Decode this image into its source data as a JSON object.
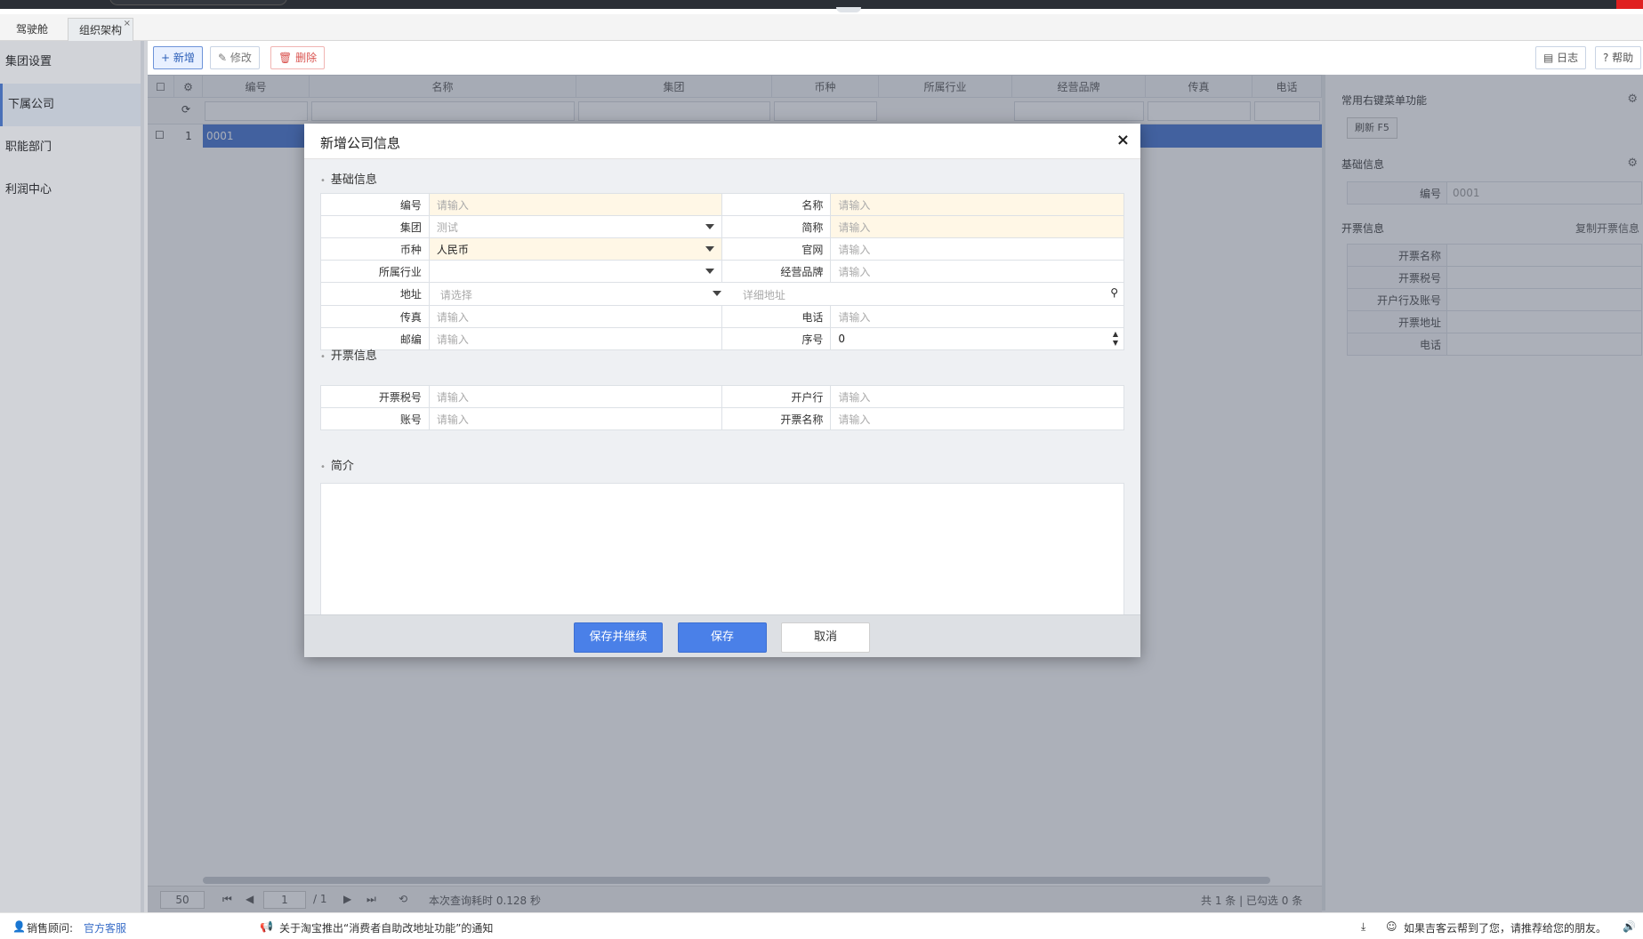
{
  "tabs": [
    {
      "label": "驾驶舱"
    },
    {
      "label": "组织架构",
      "close": "×"
    }
  ],
  "left_nav": [
    "集团设置",
    "下属公司",
    "职能部门",
    "利润中心"
  ],
  "toolbar": {
    "add_label": "+ 新增",
    "edit_label": "修改",
    "delete_label": "删除",
    "log_label": "日志",
    "help_label": "? 帮助"
  },
  "grid": {
    "columns": [
      "编号",
      "名称",
      "集团",
      "币种",
      "所属行业",
      "经营品牌",
      "传真",
      "电话"
    ],
    "rows": [
      {
        "index": "1",
        "code": "0001"
      }
    ]
  },
  "right_panel": {
    "context_menu_title": "常用右键菜单功能",
    "refresh_button": "刷新  F5",
    "basic_title": "基础信息",
    "basic_fields": [
      {
        "label": "编号",
        "value": "0001"
      }
    ],
    "invoice_title": "开票信息",
    "copy_invoice": "复制开票信息",
    "invoice_fields": [
      "开票名称",
      "开票税号",
      "开户行及账号",
      "开票地址",
      "电话"
    ]
  },
  "modal": {
    "title": "新增公司信息",
    "close": "×",
    "section_basic": "基础信息",
    "section_invoice": "开票信息",
    "section_intro": "简介",
    "basic": {
      "code_label": "编号",
      "code_placeholder": "请输入",
      "name_label": "名称",
      "name_placeholder": "请输入",
      "group_label": "集团",
      "group_value": "测试",
      "short_label": "简称",
      "short_placeholder": "请输入",
      "currency_label": "币种",
      "currency_value": "人民币",
      "website_label": "官网",
      "website_placeholder": "请输入",
      "industry_label": "所属行业",
      "brand_label": "经营品牌",
      "brand_placeholder": "请输入",
      "address_label": "地址",
      "address_placeholder": "请选择",
      "address_detail_placeholder": "详细地址",
      "fax_label": "传真",
      "fax_placeholder": "请输入",
      "phone_label": "电话",
      "phone_placeholder": "请输入",
      "zip_label": "邮编",
      "zip_placeholder": "请输入",
      "seq_label": "序号",
      "seq_value": "0"
    },
    "invoice": {
      "tax_label": "开票税号",
      "tax_placeholder": "请输入",
      "bank_label": "开户行",
      "bank_placeholder": "请输入",
      "account_label": "账号",
      "account_placeholder": "请输入",
      "inv_name_label": "开票名称",
      "inv_name_placeholder": "请输入"
    },
    "buttons": {
      "save_continue": "保存并继续",
      "save": "保存",
      "cancel": "取消"
    }
  },
  "pager": {
    "page_size": "50",
    "page": "1",
    "total_pages": "/ 1",
    "query_time": "本次查询耗时 0.128 秒",
    "summary": "共 1 条 | 已勾选 0 条"
  },
  "statusbar": {
    "advisor_label": "销售顾问:",
    "advisor_link": "官方客服",
    "notice": "关于淘宝推出“消费者自助改地址功能”的通知",
    "recommend": "如果吉客云帮到了您，请推荐给您的朋友。"
  }
}
